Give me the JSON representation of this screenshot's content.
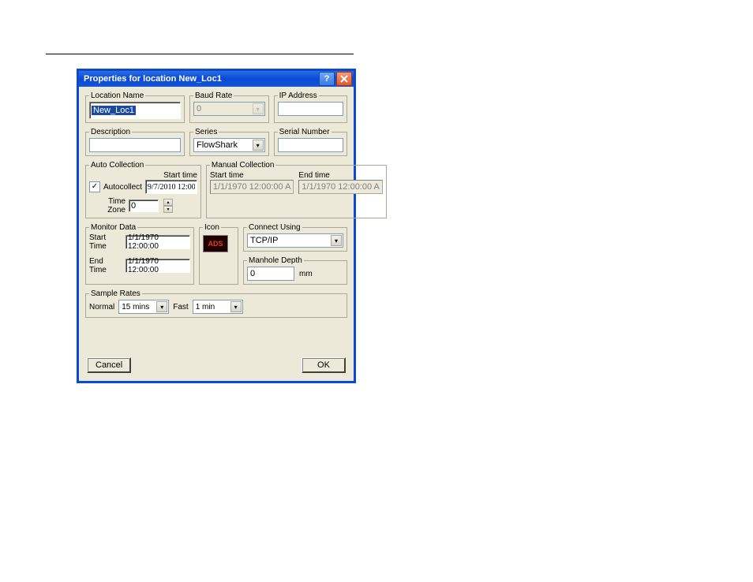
{
  "titlebar": {
    "title": "Properties for location New_Loc1"
  },
  "row1": {
    "locationName": {
      "label": "Location Name",
      "value": "New_Loc1"
    },
    "baudRate": {
      "label": "Baud Rate",
      "value": "0"
    },
    "ipAddress": {
      "label": "IP Address",
      "value": ""
    }
  },
  "row1b": {
    "description": {
      "label": "Description",
      "value": ""
    },
    "series": {
      "label": "Series",
      "value": "FlowShark"
    },
    "serialNumber": {
      "label": "Serial Number",
      "value": ""
    }
  },
  "autoCollection": {
    "label": "Auto Collection",
    "startTimeLabel": "Start time",
    "checkboxLabel": "Autocollect",
    "checkboxChecked": true,
    "startTimeValue": "9/7/2010 12:00:",
    "timeZoneLabel": "Time Zone",
    "timeZoneValue": "0"
  },
  "manualCollection": {
    "label": "Manual Collection",
    "startLabel": "Start time",
    "endLabel": "End time",
    "startValue": "1/1/1970 12:00:00 A",
    "endValue": "1/1/1970 12:00:00 A"
  },
  "monitorData": {
    "label": "Monitor Data",
    "startLabel": "Start Time",
    "startValue": "1/1/1970 12:00:00",
    "endLabel": "End Time",
    "endValue": "1/1/1970 12:00:00"
  },
  "iconGroup": {
    "label": "Icon",
    "iconText": "ADS"
  },
  "connectUsing": {
    "label": "Connect Using",
    "value": "TCP/IP"
  },
  "manholeDepth": {
    "label": "Manhole Depth",
    "value": "0",
    "unit": "mm"
  },
  "sampleRates": {
    "label": "Sample Rates",
    "normalLabel": "Normal",
    "normalValue": "15 mins",
    "fastLabel": "Fast",
    "fastValue": "1 min"
  },
  "buttons": {
    "cancel": "Cancel",
    "ok": "OK"
  }
}
